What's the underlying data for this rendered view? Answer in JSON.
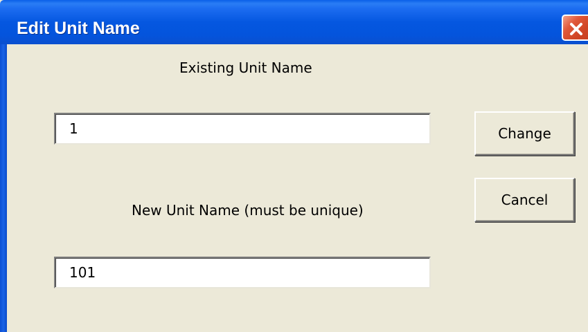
{
  "window": {
    "title": "Edit Unit Name"
  },
  "form": {
    "existing_label": "Existing Unit Name",
    "existing_value": "1",
    "new_label": "New Unit Name (must be unique)",
    "new_value": "101"
  },
  "buttons": {
    "change_label": "Change",
    "cancel_label": "Cancel"
  },
  "icons": {
    "close": "close-icon"
  },
  "colors": {
    "titlebar": "#0454dc",
    "dialog_background": "#ece9d8",
    "close_button": "#d04524"
  }
}
